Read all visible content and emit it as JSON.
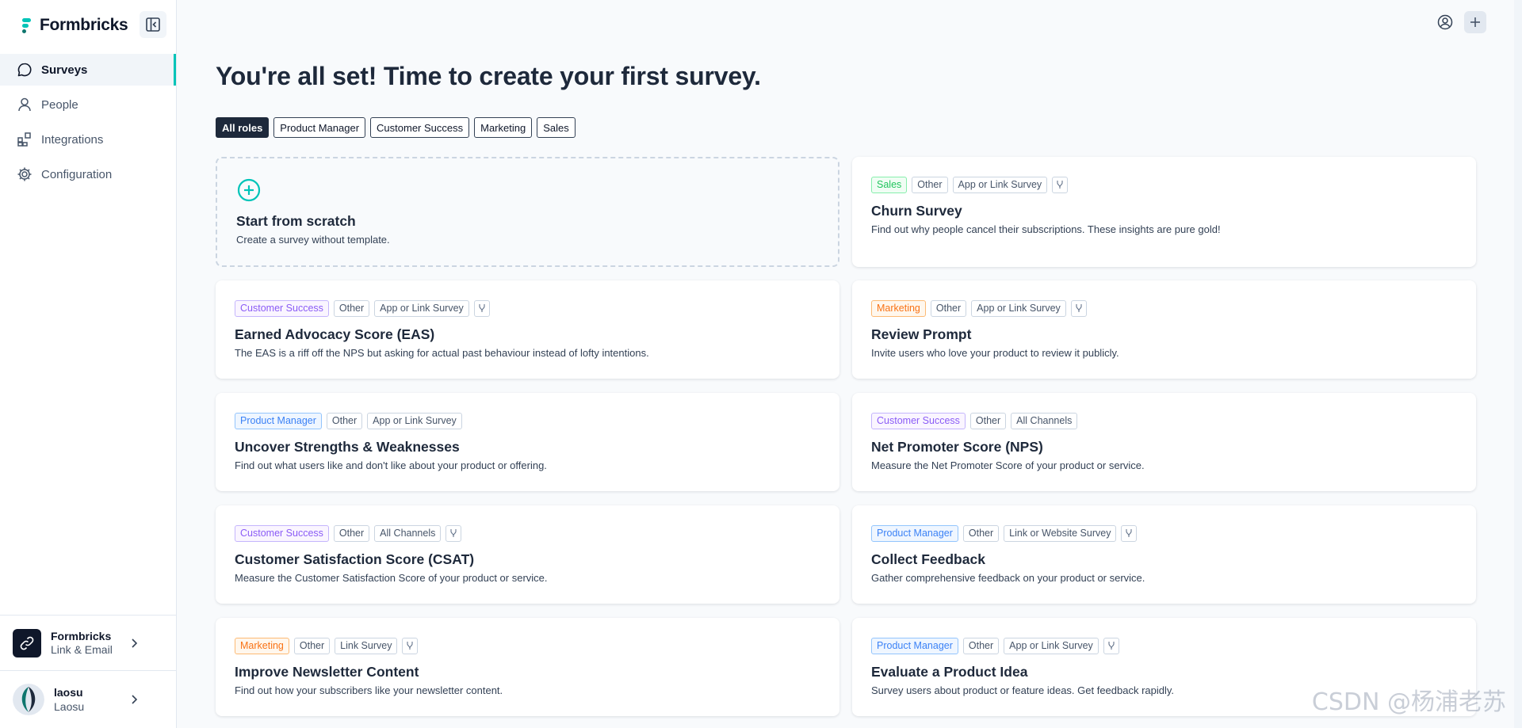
{
  "brand": {
    "name": "Formbricks"
  },
  "nav": [
    {
      "label": "Surveys",
      "icon": "message-circle-icon",
      "active": true
    },
    {
      "label": "People",
      "icon": "user-icon",
      "active": false
    },
    {
      "label": "Integrations",
      "icon": "blocks-icon",
      "active": false
    },
    {
      "label": "Configuration",
      "icon": "gear-icon",
      "active": false
    }
  ],
  "environment": {
    "name": "Formbricks",
    "subtitle": "Link & Email"
  },
  "user": {
    "name": "laosu",
    "org": "Laosu"
  },
  "page_title": "You're all set! Time to create your first survey.",
  "filters": [
    "All roles",
    "Product Manager",
    "Customer Success",
    "Marketing",
    "Sales"
  ],
  "scratch": {
    "title": "Start from scratch",
    "desc": "Create a survey without template."
  },
  "templates": [
    {
      "tags": [
        "Sales",
        "Other",
        "App or Link Survey"
      ],
      "branch": true,
      "title": "Churn Survey",
      "desc": "Find out why people cancel their subscriptions. These insights are pure gold!"
    },
    {
      "tags": [
        "Customer Success",
        "Other",
        "App or Link Survey"
      ],
      "branch": true,
      "title": "Earned Advocacy Score (EAS)",
      "desc": "The EAS is a riff off the NPS but asking for actual past behaviour instead of lofty intentions."
    },
    {
      "tags": [
        "Marketing",
        "Other",
        "App or Link Survey"
      ],
      "branch": true,
      "title": "Review Prompt",
      "desc": "Invite users who love your product to review it publicly."
    },
    {
      "tags": [
        "Product Manager",
        "Other",
        "App or Link Survey"
      ],
      "branch": false,
      "title": "Uncover Strengths & Weaknesses",
      "desc": "Find out what users like and don't like about your product or offering."
    },
    {
      "tags": [
        "Customer Success",
        "Other",
        "All Channels"
      ],
      "branch": false,
      "title": "Net Promoter Score (NPS)",
      "desc": "Measure the Net Promoter Score of your product or service."
    },
    {
      "tags": [
        "Customer Success",
        "Other",
        "All Channels"
      ],
      "branch": true,
      "title": "Customer Satisfaction Score (CSAT)",
      "desc": "Measure the Customer Satisfaction Score of your product or service."
    },
    {
      "tags": [
        "Product Manager",
        "Other",
        "Link or Website Survey"
      ],
      "branch": true,
      "title": "Collect Feedback",
      "desc": "Gather comprehensive feedback on your product or service."
    },
    {
      "tags": [
        "Marketing",
        "Other",
        "Link Survey"
      ],
      "branch": true,
      "title": "Improve Newsletter Content",
      "desc": "Find out how your subscribers like your newsletter content."
    },
    {
      "tags": [
        "Product Manager",
        "Other",
        "App or Link Survey"
      ],
      "branch": true,
      "title": "Evaluate a Product Idea",
      "desc": "Survey users about product or feature ideas. Get feedback rapidly."
    }
  ],
  "watermark": "CSDN @杨浦老苏",
  "colors": {
    "brand_accent": "#00c4b8",
    "sales": "#22c55e",
    "customer_success": "#8b5cf6",
    "marketing": "#f97316",
    "product_manager": "#3b82f6"
  }
}
